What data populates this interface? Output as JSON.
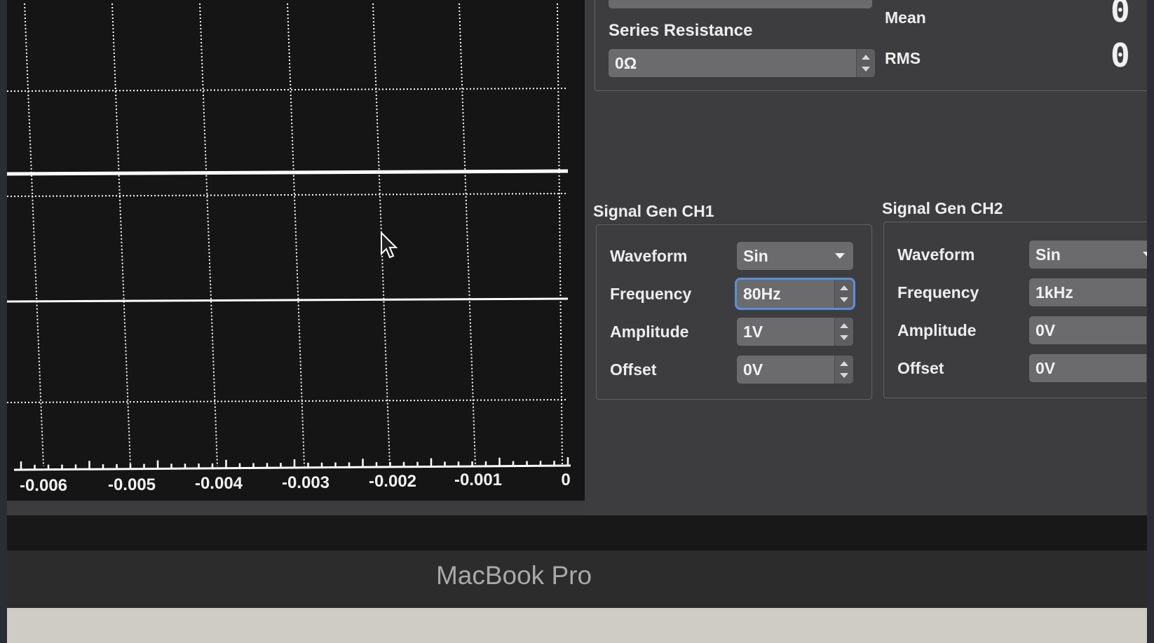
{
  "scope": {
    "x_ticks": [
      "-0.006",
      "-0.005",
      "-0.004",
      "-0.003",
      "-0.002",
      "-0.001",
      "0"
    ],
    "background_color": "#151515",
    "grid_color": "#ffffff"
  },
  "measurements": {
    "mean_label": "Mean",
    "mean_value": "0",
    "rms_label": "RMS",
    "rms_value": "0"
  },
  "series_resistance": {
    "label": "Series Resistance",
    "value": "0Ω"
  },
  "ch1": {
    "title": "Signal Gen CH1",
    "waveform_label": "Waveform",
    "waveform_value": "Sin",
    "frequency_label": "Frequency",
    "frequency_value": "80Hz",
    "amplitude_label": "Amplitude",
    "amplitude_value": "1V",
    "offset_label": "Offset",
    "offset_value": "0V"
  },
  "ch2": {
    "title": "Signal Gen CH2",
    "waveform_label": "Waveform",
    "waveform_value": "Sin",
    "frequency_label": "Frequency",
    "frequency_value": "1kHz",
    "amplitude_label": "Amplitude",
    "amplitude_value": "0V",
    "offset_label": "Offset",
    "offset_value": "0V"
  },
  "laptop": {
    "brand": "MacBook Pro"
  },
  "colors": {
    "panel": "#3d3d3f",
    "field": "#6b6b6d",
    "focus_ring": "#5b8fd8"
  }
}
